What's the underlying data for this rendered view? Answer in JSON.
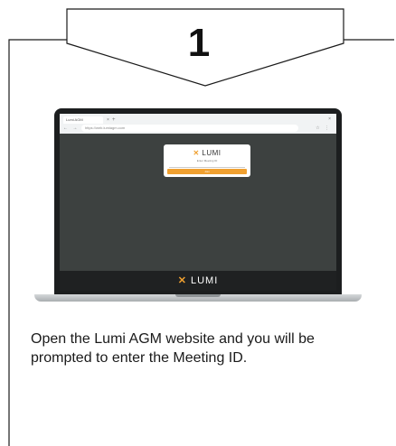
{
  "step": {
    "number": "1",
    "description": "Open the Lumi AGM website and you will be prompted to enter the Meeting ID."
  },
  "laptop": {
    "browser": {
      "tab_title": "Lumi AGM",
      "tab_close": "×",
      "new_tab": "+",
      "window_close": "×",
      "nav": "← → ⟳",
      "url": "https://web.lumiagm.com",
      "toolbar": "☆ ⋮"
    },
    "login_card": {
      "logo_mark": "✕",
      "logo_text": "LUMI",
      "prompt": "Enter Meeting ID",
      "button_label": "Join"
    },
    "footer": {
      "logo_mark": "✕",
      "logo_text": "LUMI"
    }
  },
  "colors": {
    "accent": "#f0a030",
    "screen_background": "#3d4140",
    "frame_line": "#1a1a1a"
  }
}
